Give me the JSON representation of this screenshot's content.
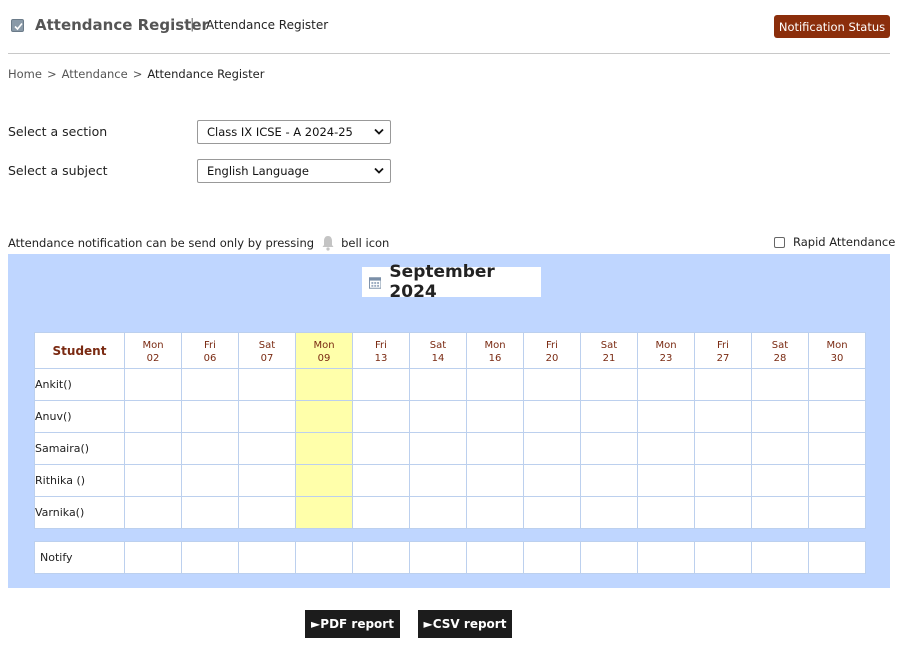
{
  "header": {
    "title": "Attendance Register",
    "separator": "|",
    "subtitle": "Attendance Register",
    "notification_button": "Notification Status"
  },
  "breadcrumb": {
    "items": [
      "Home",
      "Attendance",
      "Attendance Register"
    ],
    "separator": ">"
  },
  "form": {
    "section_label": "Select a section",
    "section_value": "Class IX ICSE - A 2024-25",
    "subject_label": "Select a subject",
    "subject_value": "English Language"
  },
  "notice": {
    "text_before": "Attendance notification can be send only by pressing",
    "text_after": "bell icon",
    "icon": "bell-icon"
  },
  "rapid_attendance": {
    "label": "Rapid Attendance",
    "checked": false
  },
  "calendar": {
    "month": "September 2024",
    "student_header": "Student",
    "days": [
      {
        "day": "Mon",
        "date": "02"
      },
      {
        "day": "Fri",
        "date": "06"
      },
      {
        "day": "Sat",
        "date": "07"
      },
      {
        "day": "Mon",
        "date": "09",
        "highlighted": true
      },
      {
        "day": "Fri",
        "date": "13"
      },
      {
        "day": "Sat",
        "date": "14"
      },
      {
        "day": "Mon",
        "date": "16"
      },
      {
        "day": "Fri",
        "date": "20"
      },
      {
        "day": "Sat",
        "date": "21"
      },
      {
        "day": "Mon",
        "date": "23"
      },
      {
        "day": "Fri",
        "date": "27"
      },
      {
        "day": "Sat",
        "date": "28"
      },
      {
        "day": "Mon",
        "date": "30"
      }
    ],
    "students": [
      "Ankit()",
      "Anuv()",
      "Samaira()",
      "Rithika ()",
      "Varnika()"
    ],
    "notify_label": "Notify"
  },
  "reports": {
    "pdf": "►PDF report",
    "csv": "►CSV report"
  },
  "colors": {
    "accent_button": "#8b2e0b",
    "panel_bg": "#bfd6ff",
    "highlight": "#ffffaa",
    "header_text": "#7a2a12"
  }
}
